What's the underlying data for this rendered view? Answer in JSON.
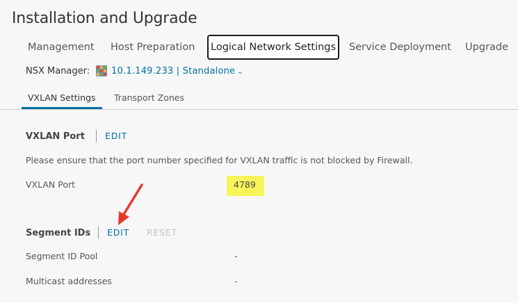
{
  "page": {
    "title": "Installation and Upgrade"
  },
  "main_tabs": [
    {
      "label": "Management",
      "active": false
    },
    {
      "label": "Host Preparation",
      "active": false
    },
    {
      "label": "Logical Network Settings",
      "active": true
    },
    {
      "label": "Service Deployment",
      "active": false
    },
    {
      "label": "Upgrade",
      "active": false
    }
  ],
  "manager": {
    "label": "NSX Manager:",
    "value": "10.1.149.233 | Standalone",
    "icon": "nsx-manager-icon"
  },
  "sub_tabs": [
    {
      "label": "VXLAN Settings",
      "active": true
    },
    {
      "label": "Transport Zones",
      "active": false
    }
  ],
  "vxlan": {
    "title": "VXLAN Port",
    "edit_label": "EDIT",
    "note": "Please ensure that the port number specified for VXLAN traffic is not blocked by Firewall.",
    "port_label": "VXLAN Port",
    "port_value": "4789"
  },
  "segment": {
    "title": "Segment IDs",
    "edit_label": "EDIT",
    "reset_label": "RESET",
    "pool_label": "Segment ID Pool",
    "pool_value": "-",
    "multicast_label": "Multicast addresses",
    "multicast_value": "-"
  },
  "colors": {
    "link": "#0072a3",
    "highlight": "#f7f55a",
    "arrow": "#e8362d",
    "tab_underline": "#0072a3"
  }
}
